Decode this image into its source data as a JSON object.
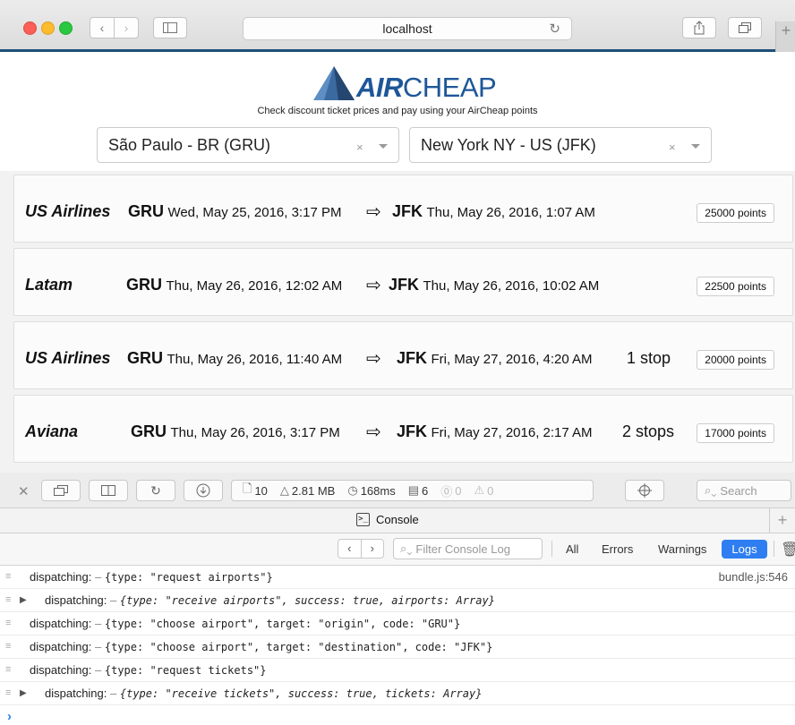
{
  "browser": {
    "url": "localhost"
  },
  "app": {
    "logo_air": "AIR",
    "logo_cheap": "CHEAP",
    "tagline": "Check discount ticket prices and pay using your AirCheap points",
    "origin": {
      "value": "São Paulo - BR (GRU)",
      "clear": "×"
    },
    "destination": {
      "value": "New York NY - US (JFK)",
      "clear": "×"
    },
    "tickets": [
      {
        "airline": "US Airlines",
        "from_code": "GRU",
        "from_time": "Wed, May 25, 2016, 3:17 PM",
        "to_code": "JFK",
        "to_time": "Thu, May 26, 2016, 1:07 AM",
        "stops": "",
        "points": "25000 points"
      },
      {
        "airline": "Latam",
        "from_code": "GRU",
        "from_time": "Thu, May 26, 2016, 12:02 AM",
        "to_code": "JFK",
        "to_time": "Thu, May 26, 2016, 10:02 AM",
        "stops": "",
        "points": "22500 points"
      },
      {
        "airline": "US Airlines",
        "from_code": "GRU",
        "from_time": "Thu, May 26, 2016, 11:40 AM",
        "to_code": "JFK",
        "to_time": "Fri, May 27, 2016, 4:20 AM",
        "stops": "1 stop",
        "points": "20000 points"
      },
      {
        "airline": "Aviana",
        "from_code": "GRU",
        "from_time": "Thu, May 26, 2016, 3:17 PM",
        "to_code": "JFK",
        "to_time": "Fri, May 27, 2016, 2:17 AM",
        "stops": "2 stops",
        "points": "17000 points"
      }
    ]
  },
  "devtools": {
    "stats": {
      "resources": "10",
      "size": "2.81 MB",
      "time": "168ms",
      "logs": "6",
      "errors": "0",
      "warnings": "0"
    },
    "search_placeholder": "Search",
    "tab_label": "Console",
    "filter_placeholder": "Filter Console Log",
    "levels": {
      "all": "All",
      "errors": "Errors",
      "warnings": "Warnings",
      "logs": "Logs"
    },
    "log_label": "dispatching:",
    "source": "bundle.js:546",
    "log_objects": [
      "{type: \"request airports\"}",
      "{type: \"receive airports\", success: true, airports: Array}",
      "{type: \"choose airport\", target: \"origin\", code: \"GRU\"}",
      "{type: \"choose airport\", target: \"destination\", code: \"JFK\"}",
      "{type: \"request tickets\"}",
      "{type: \"receive tickets\", success: true, tickets: Array}"
    ]
  },
  "colors": {
    "brand": "#1e5799",
    "accent_blue": "#2e7ef1",
    "chrome_border": "#1f4f77"
  }
}
